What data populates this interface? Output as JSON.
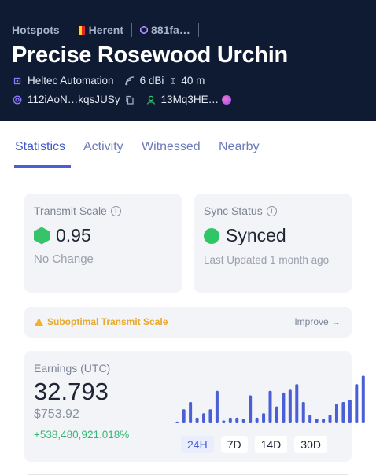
{
  "header": {
    "breadcrumb": {
      "root": "Hotspots",
      "location": "Herent",
      "hex": "881fa…"
    },
    "title": "Precise Rosewood Urchin",
    "maker": "Heltec Automation",
    "gain": "6 dBi",
    "elevation": "40 m",
    "address": "112iAoN…kqsJUSy",
    "owner": "13Mq3HE…",
    "flag_colors": [
      "#1a1a1a",
      "#f5d422",
      "#e0262c"
    ],
    "colors": {
      "background": "#0f1a33",
      "hex_icon": "#b48cff",
      "owner_icon": "#35c46a",
      "address_icon": "#8c7bff"
    },
    "icons": [
      "chip-icon",
      "signal-icon",
      "elevation-icon",
      "at-icon",
      "copy-icon",
      "person-icon",
      "avatar-icon"
    ]
  },
  "tabs": [
    {
      "label": "Statistics",
      "active": true
    },
    {
      "label": "Activity",
      "active": false
    },
    {
      "label": "Witnessed",
      "active": false
    },
    {
      "label": "Nearby",
      "active": false
    }
  ],
  "transmit": {
    "label": "Transmit Scale",
    "value": "0.95",
    "change": "No Change",
    "color": "#35c46a"
  },
  "sync": {
    "label": "Sync Status",
    "value": "Synced",
    "updated": "Last Updated 1 month ago",
    "color": "#2ec765"
  },
  "warning": {
    "text": "Suboptimal Transmit Scale",
    "action": "Improve →",
    "color": "#e8a92a"
  },
  "earnings": {
    "label": "Earnings (UTC)",
    "value": "32.793",
    "usd": "$753.92",
    "change": "+538,480,921.018%",
    "ranges": [
      {
        "label": "24H",
        "active": true
      },
      {
        "label": "7D",
        "active": false
      },
      {
        "label": "14D",
        "active": false
      },
      {
        "label": "30D",
        "active": false
      }
    ]
  },
  "chart_data": {
    "type": "bar",
    "values": [
      3,
      25,
      38,
      10,
      18,
      25,
      58,
      5,
      10,
      10,
      8,
      50,
      10,
      18,
      58,
      30,
      55,
      60,
      70,
      38,
      15,
      8,
      8,
      15,
      35,
      38,
      42,
      70,
      85
    ],
    "color": "#4a5fd6",
    "ylim": [
      0,
      90
    ]
  }
}
